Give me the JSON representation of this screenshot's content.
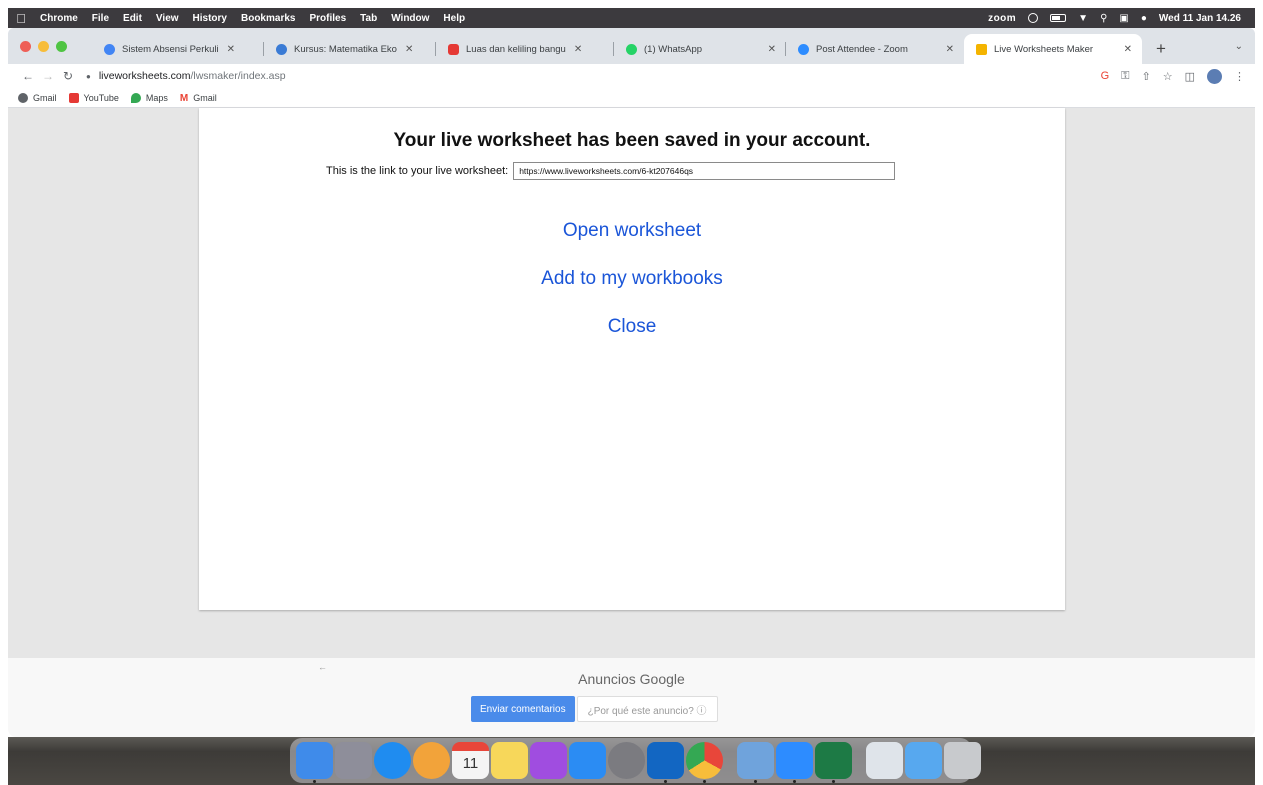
{
  "menubar": {
    "app_name": "Chrome",
    "items": [
      "File",
      "Edit",
      "View",
      "History",
      "Bookmarks",
      "Profiles",
      "Tab",
      "Window",
      "Help"
    ],
    "zoom_label": "zoom",
    "datetime": "Wed 11 Jan 14.26"
  },
  "tabs": [
    {
      "title": "Sistem Absensi Perkuli",
      "close": "✕",
      "color": "#4285f4"
    },
    {
      "title": "Kursus: Matematika Eko",
      "close": "✕",
      "color": "#3a7bd5"
    },
    {
      "title": "Luas dan keliling bangu",
      "close": "✕",
      "color": "#e53935"
    },
    {
      "title": "(1) WhatsApp",
      "close": "✕",
      "color": "#25d366"
    },
    {
      "title": "Post Attendee - Zoom",
      "close": "✕",
      "color": "#2d8cff"
    },
    {
      "title": "Live Worksheets Maker",
      "close": "✕",
      "color": "#f4b400"
    }
  ],
  "toolbar": {
    "url_host": "liveworksheets.com",
    "url_path": "/lwsmaker/index.asp"
  },
  "bookmarks": [
    {
      "label": "Gmail",
      "color": "#5f6368"
    },
    {
      "label": "YouTube",
      "color": "#e53935"
    },
    {
      "label": "Maps",
      "color": "#34a853"
    },
    {
      "label": "Gmail",
      "color": "#ea4335"
    }
  ],
  "page": {
    "heading": "Your live worksheet has been saved in your account.",
    "link_label": "This is the link to your live worksheet:",
    "link_value": "https://www.liveworksheets.com/6-kt207646qs",
    "open_label": "Open worksheet",
    "add_label": "Add to my workbooks",
    "close_label": "Close"
  },
  "ads": {
    "label": "Anuncios Google",
    "feedback_button": "Enviar comentarios",
    "why_button": "¿Por qué este anuncio? ⓘ"
  },
  "colors": {
    "link": "#1a55d8",
    "page_bg": "#e6e6e6",
    "ads_button": "#4a8bea"
  },
  "dock": [
    {
      "name": "finder",
      "color": "#3f8bea"
    },
    {
      "name": "launchpad",
      "color": "#8e8e9a"
    },
    {
      "name": "safari",
      "color": "#1f8cf0"
    },
    {
      "name": "photos",
      "color": "#f2a33a"
    },
    {
      "name": "calendar",
      "color": "#f4f4f4",
      "text": "11"
    },
    {
      "name": "notes",
      "color": "#f7d75a"
    },
    {
      "name": "podcasts",
      "color": "#a04de0"
    },
    {
      "name": "app-store",
      "color": "#2b8cf3"
    },
    {
      "name": "settings",
      "color": "#7b7b80"
    },
    {
      "name": "outlook",
      "color": "#1266c2"
    },
    {
      "name": "chrome",
      "color": "#e8463a"
    },
    {
      "name": "preview",
      "color": "#6fa3dc"
    },
    {
      "name": "zoom",
      "color": "#2d8cff"
    },
    {
      "name": "excel",
      "color": "#1d7a45"
    },
    {
      "name": "downloads",
      "color": "#dfe4ea"
    },
    {
      "name": "folder",
      "color": "#57a8ef"
    },
    {
      "name": "trash",
      "color": "#c8cacd"
    }
  ]
}
